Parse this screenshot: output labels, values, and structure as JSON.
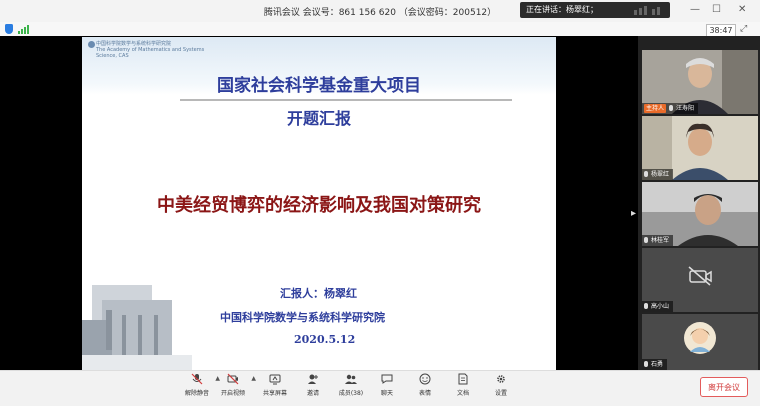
{
  "window": {
    "title": "腾讯会议 会议号：861 156 620 （会议密码：200512）",
    "speaking": "正在讲话：杨翠红；",
    "timer": "38:47"
  },
  "slide": {
    "logo_lines": [
      "中国科学院数学与系统科学研究院",
      "The Academy of Mathematics and Systems",
      "Science, CAS"
    ],
    "heading": "国家社会科学基金重大项目",
    "subheading": "开题汇报",
    "title": "中美经贸博弈的经济影响及我国对策研究",
    "reporter": "汇报人：杨翠红",
    "institute": "中国科学院数学与系统科学研究院",
    "date": "2020.5.12"
  },
  "participants": [
    {
      "name": "汪寿阳",
      "tag": "主持人"
    },
    {
      "name": "杨翠红",
      "tag": ""
    },
    {
      "name": "林桂军",
      "tag": ""
    },
    {
      "name": "高小山",
      "tag": ""
    },
    {
      "name": "石勇",
      "tag": ""
    }
  ],
  "toolbar": {
    "mute": "解除静音",
    "video": "开启视频",
    "share": "共享屏幕",
    "invite": "邀请",
    "members": "成员(38)",
    "chat": "聊天",
    "reactions": "表情",
    "docs": "文档",
    "settings": "设置",
    "leave": "离开会议"
  },
  "colors": {
    "accent": "#2e3e9c",
    "title_red": "#8b1616",
    "host_tag": "#e96b2a",
    "leave": "#d23c3c"
  }
}
